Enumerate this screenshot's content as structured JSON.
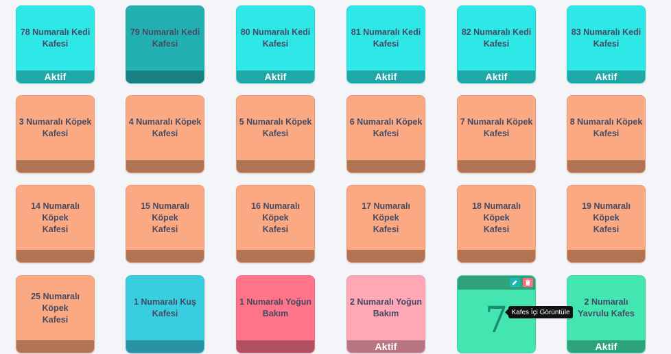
{
  "rows": [
    [
      {
        "title": "78 Numaralı Kedi\nKafesi",
        "status": "Aktif",
        "color": "#2ee8e8"
      },
      {
        "title": "79 Numaralı Kedi\nKafesi",
        "status": "",
        "color": "#22b0b0"
      },
      {
        "title": "80 Numaralı Kedi\nKafesi",
        "status": "Aktif",
        "color": "#2ee8e8"
      },
      {
        "title": "81 Numaralı Kedi\nKafesi",
        "status": "Aktif",
        "color": "#2ee8e8"
      },
      {
        "title": "82 Numaralı Kedi\nKafesi",
        "status": "Aktif",
        "color": "#2ee8e8"
      },
      {
        "title": "83 Numaralı Kedi\nKafesi",
        "status": "Aktif",
        "color": "#2ee8e8"
      }
    ],
    [
      {
        "title": "3 Numaralı Köpek\nKafesi",
        "status": "",
        "color": "#fba982"
      },
      {
        "title": "4 Numaralı Köpek\nKafesi",
        "status": "",
        "color": "#fba982"
      },
      {
        "title": "5 Numaralı Köpek\nKafesi",
        "status": "",
        "color": "#fba982"
      },
      {
        "title": "6 Numaralı Köpek\nKafesi",
        "status": "",
        "color": "#fba982"
      },
      {
        "title": "7 Numaralı Köpek\nKafesi",
        "status": "",
        "color": "#fba982"
      },
      {
        "title": "8 Numaralı Köpek\nKafesi",
        "status": "",
        "color": "#fba982"
      }
    ],
    [
      {
        "title": "14 Numaralı Köpek\nKafesi",
        "status": "",
        "color": "#fba982"
      },
      {
        "title": "15 Numaralı Köpek\nKafesi",
        "status": "",
        "color": "#fba982"
      },
      {
        "title": "16 Numaralı Köpek\nKafesi",
        "status": "",
        "color": "#fba982"
      },
      {
        "title": "17 Numaralı Köpek\nKafesi",
        "status": "",
        "color": "#fba982"
      },
      {
        "title": "18 Numaralı Köpek\nKafesi",
        "status": "",
        "color": "#fba982"
      },
      {
        "title": "19 Numaralı Köpek\nKafesi",
        "status": "",
        "color": "#fba982"
      }
    ],
    [
      {
        "title": "25 Numaralı Köpek\nKafesi",
        "status": "",
        "color": "#fba982"
      },
      {
        "title": "1 Numaralı Kuş\nKafesi",
        "status": "",
        "color": "#39cde0"
      },
      {
        "title": "1 Numaralı Yoğun\nBakım",
        "status": "",
        "color": "#ff7489"
      },
      {
        "title": "2 Numaralı Yoğun\nBakım",
        "status": "Aktif",
        "color": "#ffa7b5"
      },
      {
        "special": true,
        "number": "7",
        "status": "",
        "color": "#43e6b0",
        "edit_icon": "pencil-icon",
        "delete_icon": "trash-icon"
      },
      {
        "title": "2 Numaralı\nYavrulu Kafes",
        "status": "Aktif",
        "color": "#43e6b0"
      }
    ]
  ],
  "tooltip": {
    "text": "Kafes İçi Görüntüle"
  }
}
